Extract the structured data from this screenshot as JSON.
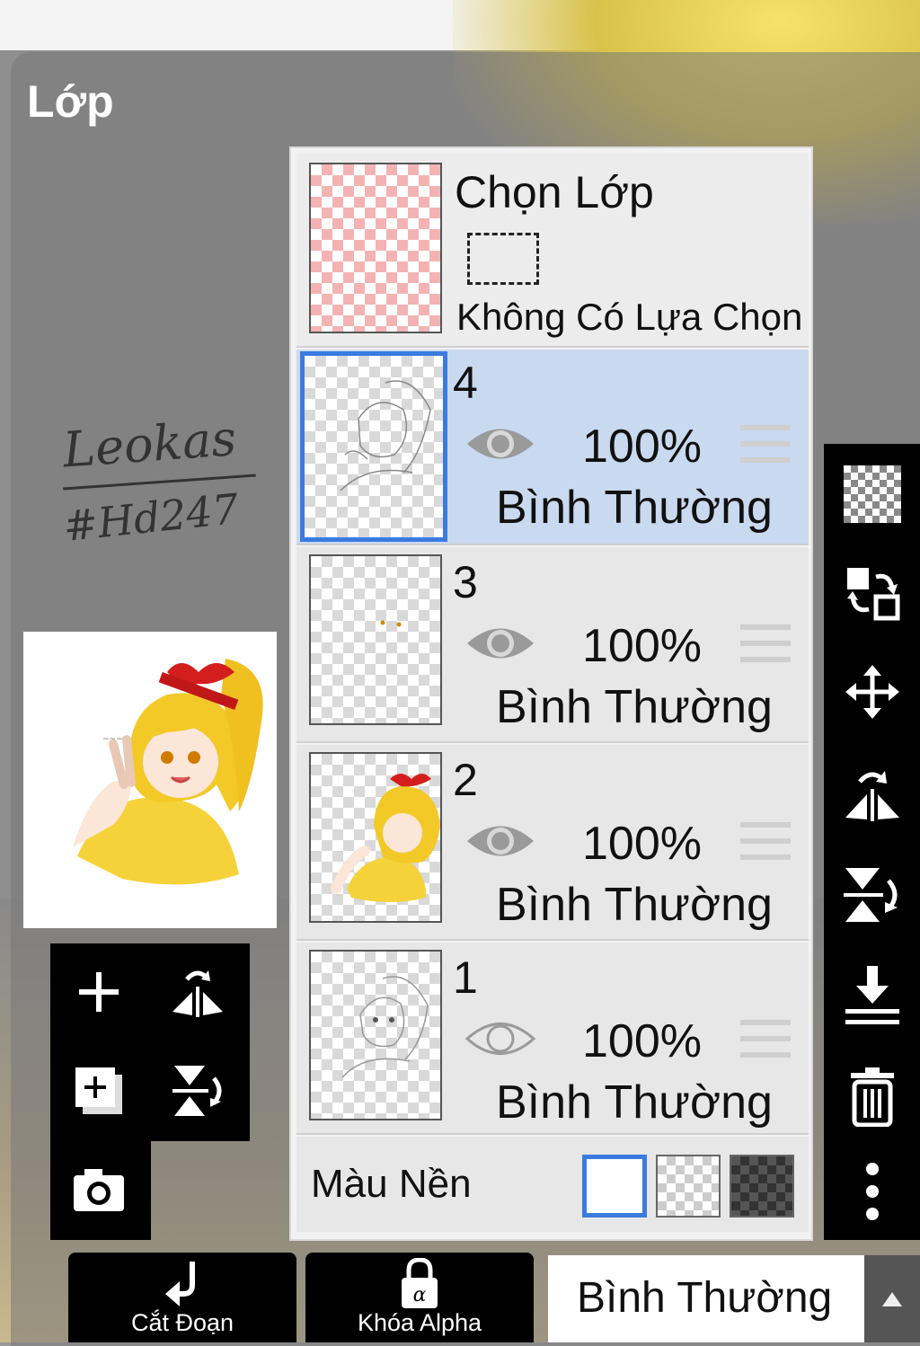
{
  "panel": {
    "title": "Lớp"
  },
  "signature": {
    "line1": "Leokas",
    "line2": "#Hd247"
  },
  "selection": {
    "title": "Chọn Lớp",
    "status": "Không Có Lựa Chọn"
  },
  "layers": [
    {
      "number": "4",
      "opacity": "100%",
      "blend": "Bình Thường",
      "visible": true,
      "selected": true
    },
    {
      "number": "3",
      "opacity": "100%",
      "blend": "Bình Thường",
      "visible": true,
      "selected": false
    },
    {
      "number": "2",
      "opacity": "100%",
      "blend": "Bình Thường",
      "visible": true,
      "selected": false
    },
    {
      "number": "1",
      "opacity": "100%",
      "blend": "Bình Thường",
      "visible": false,
      "selected": false
    }
  ],
  "background": {
    "label": "Màu Nền",
    "options": [
      "white",
      "transparent",
      "dark-checker"
    ],
    "selected": "white"
  },
  "bottom_bar": {
    "clip_label": "Cắt Đoạn",
    "alpha_label": "Khóa Alpha",
    "blend_mode": "Bình Thường"
  },
  "right_toolbar": [
    "checker-icon",
    "swap-icon",
    "move-icon",
    "flip-horizontal-icon",
    "flip-vertical-icon",
    "merge-down-icon",
    "trash-icon",
    "more-icon"
  ],
  "left_toolbar": [
    "add-layer-icon",
    "flip-horizontal-icon",
    "duplicate-layer-icon",
    "flip-vertical-icon",
    "camera-icon"
  ],
  "colors": {
    "accent": "#3a7be0",
    "selected_row": "#c9d9ef",
    "row": "#e7e7e7"
  }
}
